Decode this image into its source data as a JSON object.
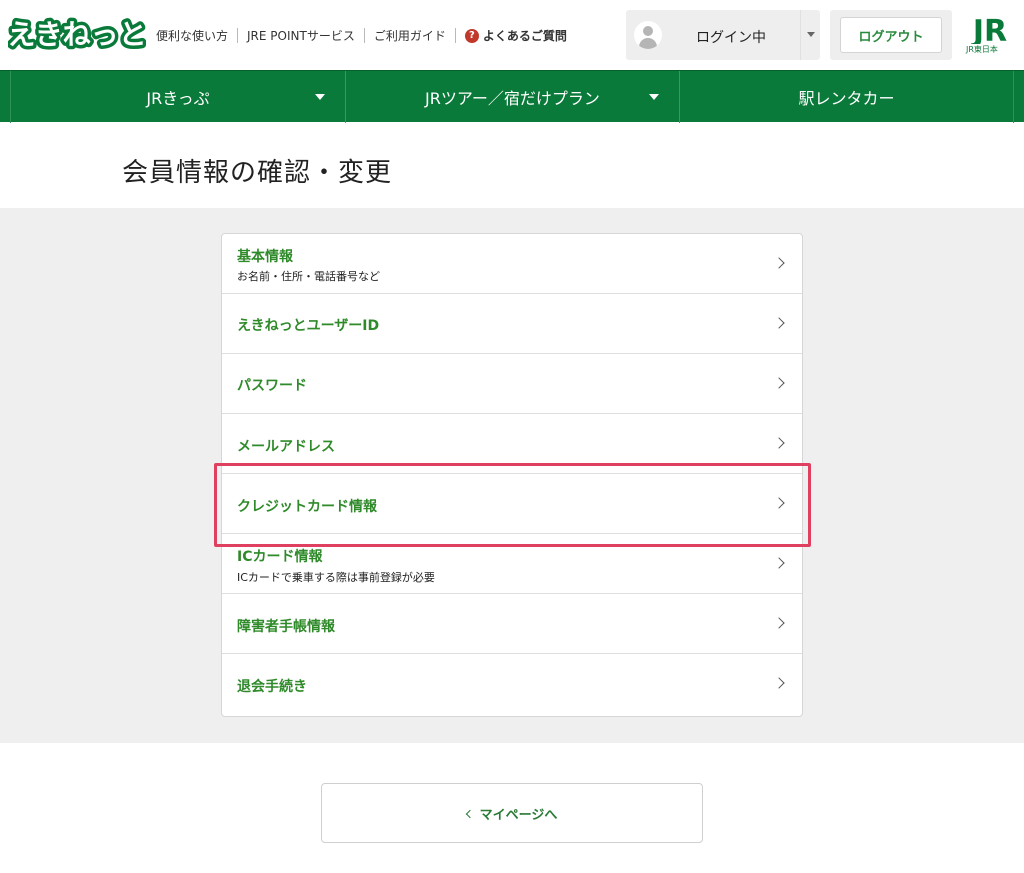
{
  "header": {
    "logo_text": "えきねっと",
    "links": [
      "便利な使い方",
      "JRE POINTサービス",
      "ご利用ガイド"
    ],
    "faq_label": "よくあるご質問",
    "faq_icon": "?",
    "login_status": "ログイン中",
    "logout_label": "ログアウト",
    "brand_logo": "JR",
    "brand_sub": "JR東日本"
  },
  "nav": {
    "items": [
      {
        "label": "JRきっぷ"
      },
      {
        "label": "JRツアー／宿だけプラン"
      },
      {
        "label": "駅レンタカー"
      }
    ]
  },
  "page": {
    "title": "会員情報の確認・変更"
  },
  "menu": {
    "items": [
      {
        "title": "基本情報",
        "subtitle": "お名前・住所・電話番号など"
      },
      {
        "title": "えきねっとユーザーID",
        "subtitle": ""
      },
      {
        "title": "パスワード",
        "subtitle": ""
      },
      {
        "title": "メールアドレス",
        "subtitle": ""
      },
      {
        "title": "クレジットカード情報",
        "subtitle": ""
      },
      {
        "title": "ICカード情報",
        "subtitle": "ICカードで乗車する際は事前登録が必要"
      },
      {
        "title": "障害者手帳情報",
        "subtitle": ""
      },
      {
        "title": "退会手続き",
        "subtitle": ""
      }
    ]
  },
  "footer": {
    "mypage_label": "マイページへ"
  },
  "colors": {
    "brand_green": "#0a7a3a",
    "link_green": "#2f8a2a",
    "highlight": "#e0405f"
  }
}
